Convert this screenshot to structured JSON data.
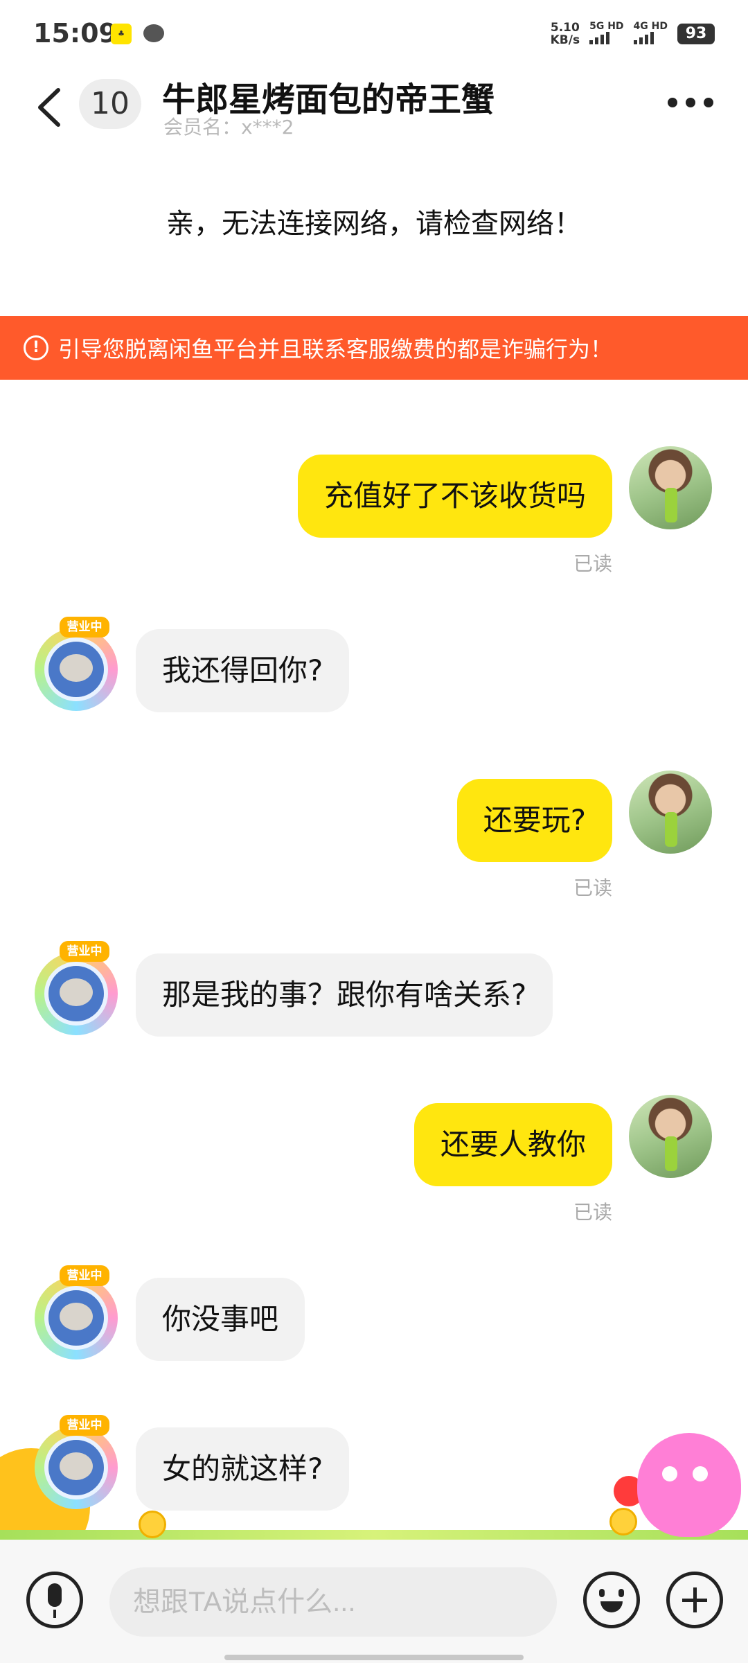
{
  "status_bar": {
    "time": "15:09",
    "speed_value": "5.10",
    "speed_unit": "KB/s",
    "net1": "5G HD",
    "net2": "4G HD",
    "battery": "93"
  },
  "header": {
    "unread_count": "10",
    "title": "牛郎星烤面包的帝王蟹",
    "subtitle": "会员名：x***2"
  },
  "notice": {
    "network": "亲，无法连接网络，请检查网络！",
    "warning": "引导您脱离闲鱼平台并且联系客服缴费的都是诈骗行为！"
  },
  "avatar_tag": "营业中",
  "messages": [
    {
      "side": "me",
      "text": "充值好了不该收货吗",
      "status": "已读"
    },
    {
      "side": "other",
      "text": "我还得回你?"
    },
    {
      "side": "me",
      "text": "还要玩?",
      "status": "已读"
    },
    {
      "side": "other",
      "text": "那是我的事？跟你有啥关系?"
    },
    {
      "side": "me",
      "text": "还要人教你",
      "status": "已读"
    },
    {
      "side": "other",
      "text": "你没事吧"
    },
    {
      "side": "other",
      "text": "女的就这样?"
    }
  ],
  "input": {
    "placeholder": "想跟TA说点什么..."
  },
  "icons": [
    "back-arrow-icon",
    "more-icon",
    "warning-icon",
    "mic-icon",
    "emoji-icon",
    "plus-icon"
  ]
}
